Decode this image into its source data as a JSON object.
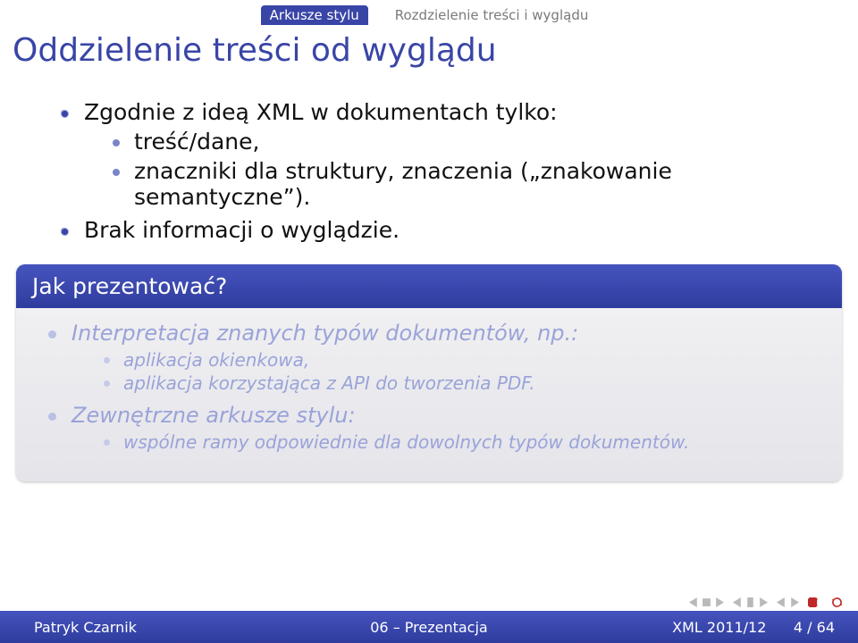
{
  "nav": {
    "section": "Arkusze stylu",
    "subsection": "Rozdzielenie treści i wyglądu"
  },
  "title": "Oddzielenie treści od wyglądu",
  "main": {
    "line1": "Zgodnie z ideą XML w dokumentach tylko:",
    "sub1": "treść/dane,",
    "sub2": "znaczniki dla struktury, znaczenia („znakowanie semantyczne”).",
    "line2": "Brak informacji o wyglądzie."
  },
  "block": {
    "title": "Jak prezentować?",
    "i1": "Interpretacja znanych typów dokumentów, np.:",
    "i1a": "aplikacja okienkowa,",
    "i1b": "aplikacja korzystająca z API do tworzenia PDF.",
    "i2": "Zewnętrzne arkusze stylu:",
    "i2a": "wspólne ramy odpowiednie dla dowolnych typów dokumentów."
  },
  "footer": {
    "author": "Patryk Czarnik",
    "doc": "06 – Prezentacja",
    "course": "XML 2011/12",
    "page": "4 / 64"
  }
}
